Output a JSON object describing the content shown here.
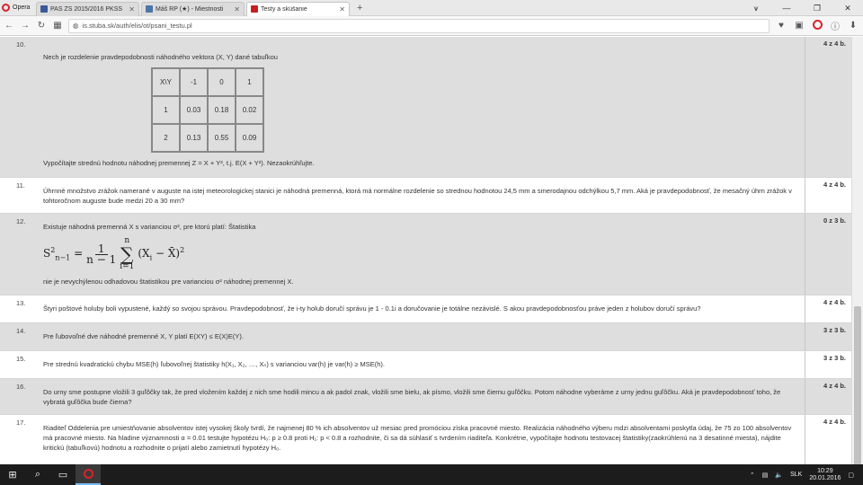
{
  "browser": {
    "menu_label": "Opera",
    "tabs": [
      {
        "title": "PAS ZS 2015/2016 PKSS",
        "color": "#3b5998"
      },
      {
        "title": "Máš RP (★) - Miestnosti",
        "color": "#4a76a8"
      },
      {
        "title": "Testy a skúšanie",
        "color": "#c81e1e"
      }
    ],
    "url": "is.stuba.sk/auth/elis/ot/psani_testu.pl"
  },
  "questions": [
    {
      "num": "10.",
      "points": "4 z 4 b.",
      "shaded": true,
      "intro": "Nech je rozdelenie pravdepodobnosti náhodného vektora  (X, Y)  dané tabuľkou",
      "table": [
        [
          "X\\Y",
          "-1",
          "0",
          "1"
        ],
        [
          "1",
          "0.03",
          "0.18",
          "0.02"
        ],
        [
          "2",
          "0.13",
          "0.55",
          "0.09"
        ]
      ],
      "outro": "Vypočítajte strednú hodnotu náhodnej premennej  Z = X + Y², t.j. E(X + Y²). Nezaokrúhľujte."
    },
    {
      "num": "11.",
      "points": "4 z 4 b.",
      "shaded": false,
      "text": "Úhrnné množstvo zrážok namerané v auguste na istej meteorologickej stanici je náhodná premenná, ktorá má normálne rozdelenie so strednou hodnotou 24,5 mm a smerodajnou odchýlkou 5,7 mm. Aká je pravdepodobnosť, že mesačný úhrn zrážok v tohtoročnom auguste bude medzi 20 a 30 mm?"
    },
    {
      "num": "12.",
      "points": "0 z 3 b.",
      "shaded": true,
      "intro": "Existuje náhodná premenná  X  s varianciou  σ², pre ktorú  platí: Štatistika",
      "outro": "nie je nevychýlenou odhadovou štatistikou pre varianciou  σ²  náhodnej premennej  X."
    },
    {
      "num": "13.",
      "points": "4 z 4 b.",
      "shaded": false,
      "text": "Štyri poštové holuby boli vypustené, každý so svojou správou. Pravdepodobnosť, že i-ty holub doručí správu je 1 - 0.1i  a doručovanie je totálne nezávislé. S akou pravdepodobnosťou práve jeden z holubov doručí správu?"
    },
    {
      "num": "14.",
      "points": "3 z 3 b.",
      "shaded": true,
      "text": "Pre ľubovoľné dve náhodné premenné  X, Y  platí  E(XY) ≤ E(X)E(Y)."
    },
    {
      "num": "15.",
      "points": "3 z 3 b.",
      "shaded": false,
      "text": "Pre strednú kvadratickú chybu  MSE(h)  ľubovoľnej štatistiky  h(X₁, X₂, …, Xₙ)  s varianciou  var(h)  je  var(h) ≥ MSE(h)."
    },
    {
      "num": "16.",
      "points": "4 z 4 b.",
      "shaded": true,
      "text": "Do urny sme postupne vložili 3 guľôčky tak, že pred vložením každej z nich sme hodili mincu a ak padol znak, vložili sme bielu, ak písmo, vložili sme čiernu guľôčku. Potom náhodne vyberáme z urny jednu guľôčku. Aká je pravdepodobnosť toho, že vybratá guľôčka bude čierna?"
    },
    {
      "num": "17.",
      "points": "4 z 4 b.",
      "shaded": false,
      "text": "Riaditeľ Oddelenia pre umiestňovanie absolventov istej vysokej školy tvrdí, že najmenej  80 %  ich absolventov už mesiac pred promóciou získa pracovné miesto. Realizácia náhodného výberu mdzi absolventami poskytla údaj, že  75  zo  100  absolventov má pracovné miesto. Na hladine významnosti  α = 0.01  testujte hypotézu  H₀: p ≥ 0.8  proti  H₁: p < 0.8  a rozhodnite, či sa dá súhlasiť s tvrdením riaditeľa. Konkrétne, vypočítajte hodnotu testovacej štatistiky(zaokrúhlenú na 3 desatinné miesta), nájdite kritickú (tabuľkovú) hodnotu a rozhodnite o prijatí alebo zamietnutí  hypotézy  H₀."
    }
  ],
  "taskbar": {
    "language": "SLK",
    "time": "10:29",
    "date": "20.01.2016"
  }
}
